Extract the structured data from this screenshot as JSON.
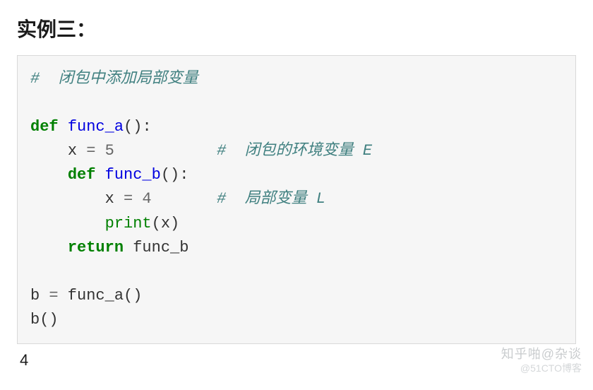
{
  "title": "实例三：",
  "code": {
    "c1": "#  闭包中添加局部变量",
    "kw_def1": "def",
    "fn_a": "func_a",
    "paren1": "()",
    "colon1": ":",
    "assign1_lhs": "x ",
    "assign1_op": "=",
    "assign1_rhs": " 5",
    "c2": "#  闭包的环境变量 E",
    "kw_def2": "def",
    "fn_b": "func_b",
    "paren2": "()",
    "colon2": ":",
    "assign2_lhs": "x ",
    "assign2_op": "=",
    "assign2_rhs": " 4",
    "c3": "#  局部变量 L",
    "print": "print",
    "print_arg_open": "(",
    "print_arg": "x",
    "print_arg_close": ")",
    "kw_return": "return",
    "return_val": " func_b",
    "b_assign_lhs": "b ",
    "b_assign_op": "=",
    "b_assign_rhs": " func_a()",
    "b_call": "b()"
  },
  "output": "4",
  "watermark1": "知乎啪@杂谈",
  "watermark2": "@51CTO博客"
}
